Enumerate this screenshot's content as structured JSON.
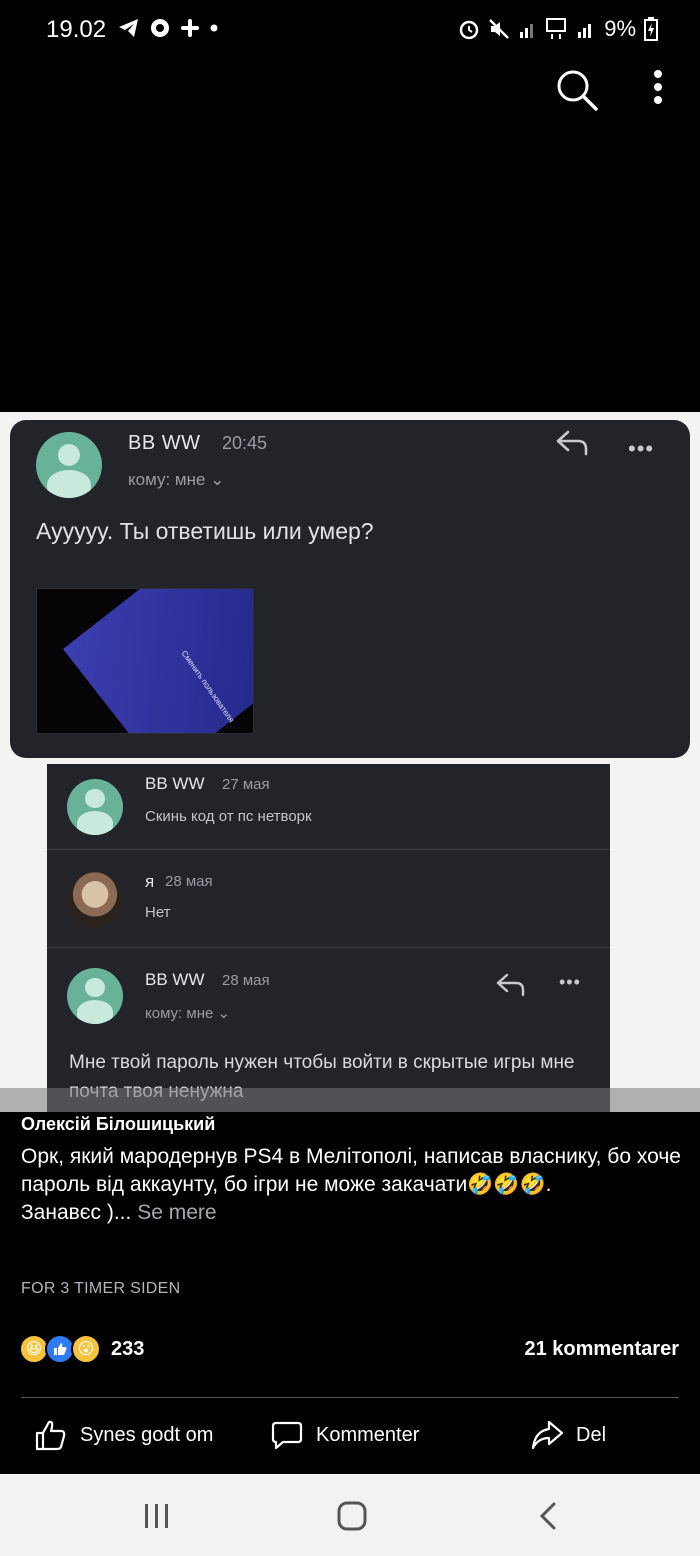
{
  "status_bar": {
    "time": "19.02",
    "battery": "9%"
  },
  "toolbar": {
    "icons": [
      "search-icon",
      "more-vert-icon"
    ]
  },
  "image": {
    "card1": {
      "sender": "BB WW",
      "time": "20:45",
      "to": "кому: мне ⌄",
      "body": "Ауууyy. Ты ответишь или умер?",
      "attachment_title": "Сменить пользователя"
    },
    "card2": {
      "rows": [
        {
          "sender": "BB WW",
          "date": "27 мая",
          "text": "Скинь код от пс нетворк"
        },
        {
          "sender": "я",
          "date": "28 мая",
          "text": "Нет"
        },
        {
          "sender": "BB WW",
          "date": "28 мая",
          "to": "кому: мне ⌄",
          "text": "Мне твой  пароль нужен чтобы войти в скрытые игры мне почта твоя ненужна"
        }
      ]
    }
  },
  "post": {
    "author": "Олексій Білошицький",
    "text": "Орк, який мародернув PS4 в Мелітополі, написав власнику, бо хоче пароль від аккаунту, бо ігри не може закачати🤣🤣🤣.",
    "text_line2": "Занавєс )...",
    "see_more": "Se mere",
    "time": "FOR 3 TIMER SIDEN",
    "reaction_count": "233",
    "comment_count": "21 kommentarer"
  },
  "actions": {
    "like": "Synes godt om",
    "comment": "Kommenter",
    "share": "Del"
  },
  "colors": {
    "background": "#000000",
    "card": "#23242a",
    "avatar": "#69b29a",
    "like_blue": "#2f7bf5"
  }
}
